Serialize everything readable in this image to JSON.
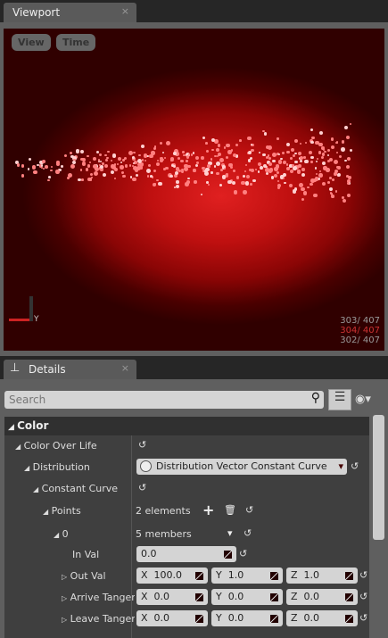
{
  "viewport": {
    "tab": "Viewport",
    "close": "×",
    "view_btn": "View",
    "time_btn": "Time",
    "axis_label": "Y",
    "stats": [
      "303/ 407",
      "304/ 407",
      "302/ 407"
    ],
    "stat_colors": [
      "#999999",
      "#cc3333",
      "#999999"
    ]
  },
  "details": {
    "tab": "Details",
    "close": "×",
    "search_placeholder": "Search",
    "category": "Color",
    "rows": [
      {
        "label": "Color Over Life",
        "expander": "◢"
      },
      {
        "label": "Distribution",
        "expander": "◢",
        "value": "Distribution Vector Constant Curve"
      },
      {
        "label": "Constant Curve",
        "expander": "◢"
      },
      {
        "label": "Points",
        "expander": "◢",
        "value": "2 elements"
      },
      {
        "label": "0",
        "expander": "◢",
        "value": "5 members"
      },
      {
        "label": "In Val",
        "value": "0.0"
      },
      {
        "label": "Out Val",
        "expander": "▷",
        "x": "100.0",
        "y": "1.0",
        "z": "1.0"
      },
      {
        "label": "Arrive Tangent",
        "expander": "▷",
        "x": "0.0",
        "y": "0.0",
        "z": "0.0"
      },
      {
        "label": "Leave Tangent",
        "expander": "▷",
        "x": "0.0",
        "y": "0.0",
        "z": "0.0"
      }
    ],
    "axis": {
      "x": "X",
      "y": "Y",
      "z": "Z"
    },
    "reset_icon": "↺"
  }
}
